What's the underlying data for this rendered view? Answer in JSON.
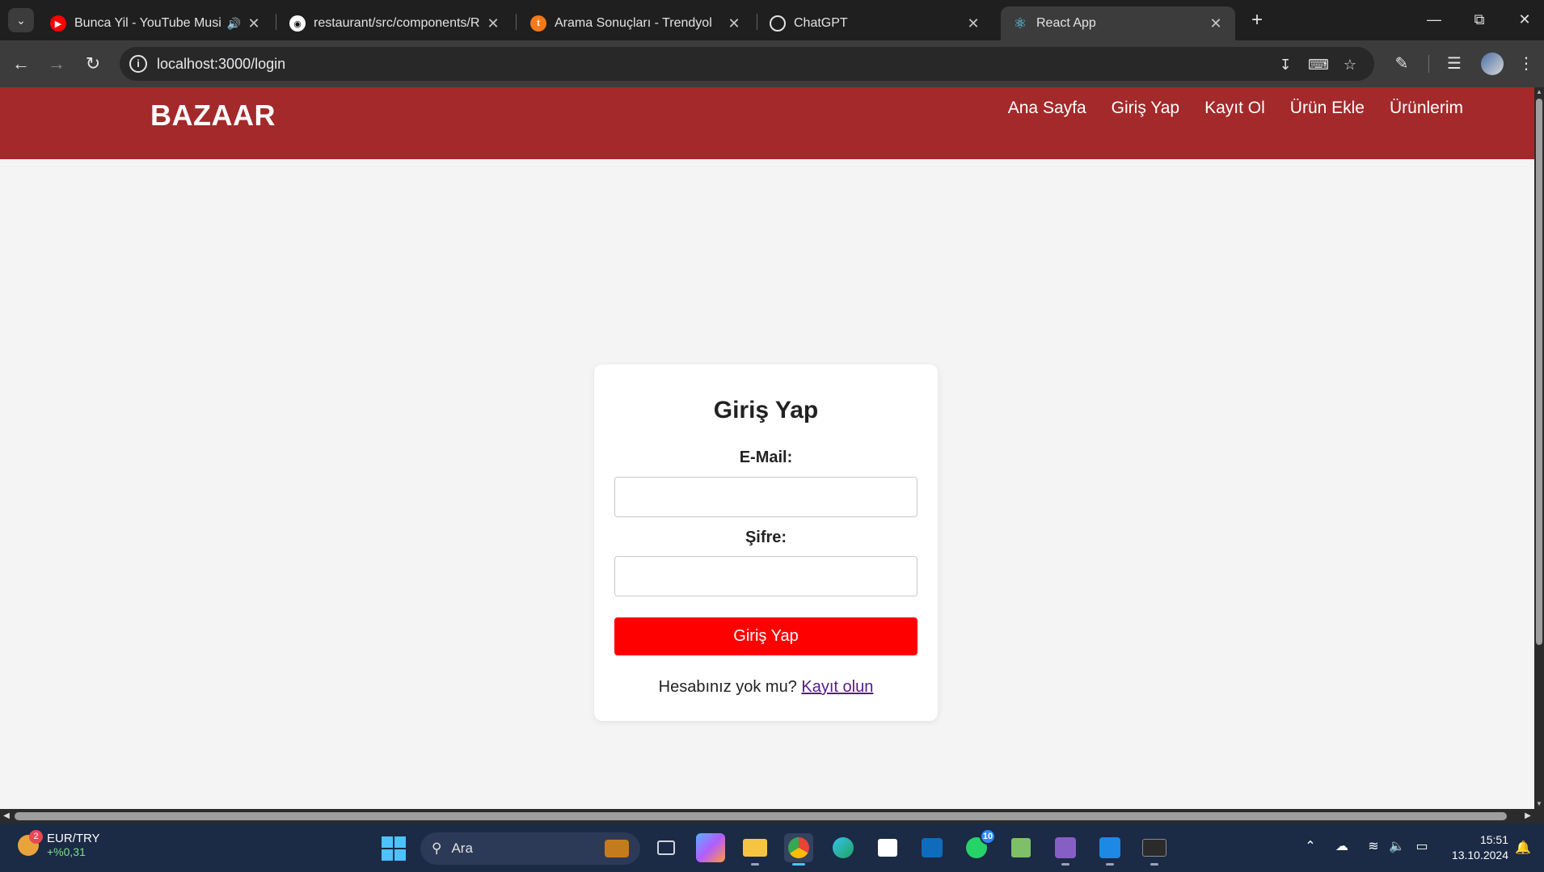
{
  "browser": {
    "tabs": [
      {
        "title": "Bunca Yil - YouTube Music",
        "icon": "youtube-music-icon",
        "active": false,
        "audio": true
      },
      {
        "title": "restaurant/src/components/Res",
        "icon": "github-icon",
        "active": false,
        "audio": false
      },
      {
        "title": "Arama Sonuçları - Trendyol",
        "icon": "trendyol-icon",
        "active": false,
        "audio": false
      },
      {
        "title": "ChatGPT",
        "icon": "chatgpt-icon",
        "active": false,
        "audio": false
      },
      {
        "title": "React App",
        "icon": "react-icon",
        "active": true,
        "audio": false
      }
    ],
    "address": "localhost:3000/login"
  },
  "app": {
    "brand": "BAZAAR",
    "nav": [
      "Ana Sayfa",
      "Giriş Yap",
      "Kayıt Ol",
      "Ürün Ekle",
      "Ürünlerim"
    ],
    "accent_color": "#a4292b"
  },
  "login": {
    "title": "Giriş Yap",
    "email_label": "E-Mail:",
    "email_value": "",
    "password_label": "Şifre:",
    "password_value": "",
    "submit_label": "Giriş Yap",
    "submit_color": "#ff0000",
    "signup_prompt": "Hesabınız yok mu?",
    "signup_link": "Kayıt olun"
  },
  "taskbar": {
    "widget_title": "EUR/TRY",
    "widget_value": "+%0,31",
    "widget_badge": "2",
    "search_placeholder": "Ara",
    "whatsapp_badge": "10",
    "time": "15:51",
    "date": "13.10.2024"
  }
}
